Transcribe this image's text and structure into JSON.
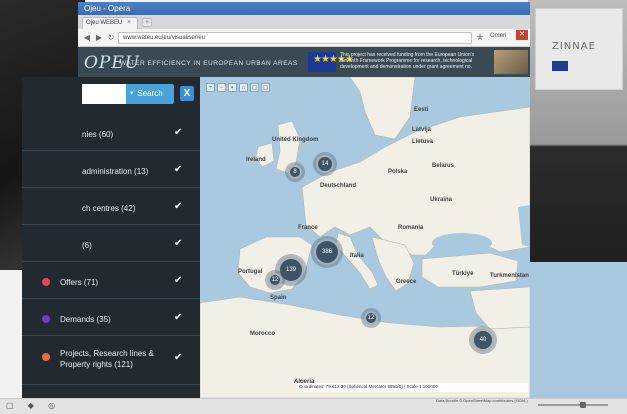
{
  "browser": {
    "window_title": "Ojeu - Opera",
    "tab_label": "Ojeu WEBEU",
    "tab_close": "×",
    "new_tab": "+",
    "url": "www.wateu.eu/eu/visualiser/eu",
    "star": "★",
    "user_label": "Omeri"
  },
  "site": {
    "logo": "OPEU",
    "tagline": "WATER EFFICIENCY IN EUROPEAN URBAN AREAS",
    "eu_text": "This project has received funding from the European Union's Seventh Framework Programme for research, technological development and demonstration under grant agreement no.",
    "eu_stars": "★★★★★"
  },
  "search": {
    "placeholder": "",
    "button_label": "Search",
    "clear_label": "X"
  },
  "categories": [
    {
      "label": "nies (60)",
      "color": "",
      "checked": "✔"
    },
    {
      "label": "administration (13)",
      "color": "",
      "checked": "✔"
    },
    {
      "label": "ch centres (42)",
      "color": "",
      "checked": "✔"
    },
    {
      "label": "(6)",
      "color": "",
      "checked": "✔"
    },
    {
      "label": "Offers (71)",
      "color": "#e8465d",
      "checked": "✔"
    },
    {
      "label": "Demands (35)",
      "color": "#6a3fc9",
      "checked": "✔"
    },
    {
      "label": "Projects, Research lines & Property rights (121)",
      "color": "#ef6b33",
      "checked": "✔"
    }
  ],
  "map": {
    "countries": [
      "United Kingdom",
      "Ireland",
      "France",
      "Deutschland",
      "Polska",
      "Portugal",
      "Spain",
      "Italia",
      "Ukraina",
      "Belarus",
      "Romania",
      "Türkiye",
      "Greece",
      "Algeria",
      "Morocco",
      "Latvija",
      "Lietuva",
      "Eesti",
      "Turkmenistan"
    ],
    "clusters": [
      "8",
      "14",
      "139",
      "386",
      "12",
      "12",
      "40"
    ],
    "coord_text": "Coordinates: 79.612.30 (Spherical Mercator 9850/0) | Scale 1:100000",
    "attribution": "Data Bundle © OpenStreetMap contributors (ODbL)",
    "tool_labels": [
      "+",
      "−",
      "◐",
      "⌂",
      "▢",
      "▢"
    ]
  },
  "photo": {
    "banner_text": "ZINNAE"
  },
  "footer": {
    "icons": "▢ ◆ ◎"
  }
}
